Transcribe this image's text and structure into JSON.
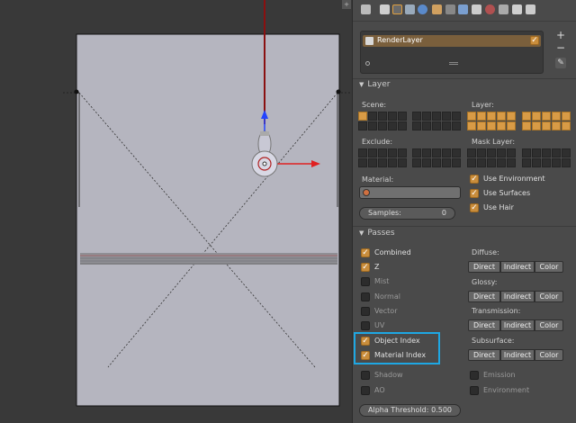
{
  "viewport": {
    "corner_label": "+"
  },
  "layers_list": {
    "active_layer": "RenderLayer",
    "add_label": "+",
    "remove_label": "−"
  },
  "layer_panel": {
    "title": "Layer",
    "scene_label": "Scene:",
    "layer_label": "Layer:",
    "exclude_label": "Exclude:",
    "mask_layer_label": "Mask Layer:",
    "material_label": "Material:",
    "samples": {
      "label": "Samples:",
      "value": "0"
    },
    "use_environment": {
      "label": "Use Environment",
      "checked": true
    },
    "use_surfaces": {
      "label": "Use Surfaces",
      "checked": true
    },
    "use_hair": {
      "label": "Use Hair",
      "checked": true
    }
  },
  "passes_panel": {
    "title": "Passes",
    "left_items": [
      {
        "label": "Combined",
        "checked": true
      },
      {
        "label": "Z",
        "checked": true
      },
      {
        "label": "Mist",
        "checked": false
      },
      {
        "label": "Normal",
        "checked": false
      },
      {
        "label": "Vector",
        "checked": false
      },
      {
        "label": "UV",
        "checked": false
      },
      {
        "label": "Object Index",
        "checked": true
      },
      {
        "label": "Material Index",
        "checked": true
      },
      {
        "label": "Shadow",
        "checked": false
      },
      {
        "label": "AO",
        "checked": false
      }
    ],
    "groups": [
      {
        "label": "Diffuse:",
        "buttons": [
          "Direct",
          "Indirect",
          "Color"
        ]
      },
      {
        "label": "Glossy:",
        "buttons": [
          "Direct",
          "Indirect",
          "Color"
        ]
      },
      {
        "label": "Transmission:",
        "buttons": [
          "Direct",
          "Indirect",
          "Color"
        ]
      },
      {
        "label": "Subsurface:",
        "buttons": [
          "Direct",
          "Indirect",
          "Color"
        ]
      }
    ],
    "emission": {
      "label": "Emission",
      "checked": false
    },
    "environment": {
      "label": "Environment",
      "checked": false
    },
    "alpha_threshold": {
      "label": "Alpha Threshold:",
      "value": "0.500"
    }
  },
  "colors": {
    "highlight": "#1ea7e3",
    "accent": "#d89b46"
  }
}
